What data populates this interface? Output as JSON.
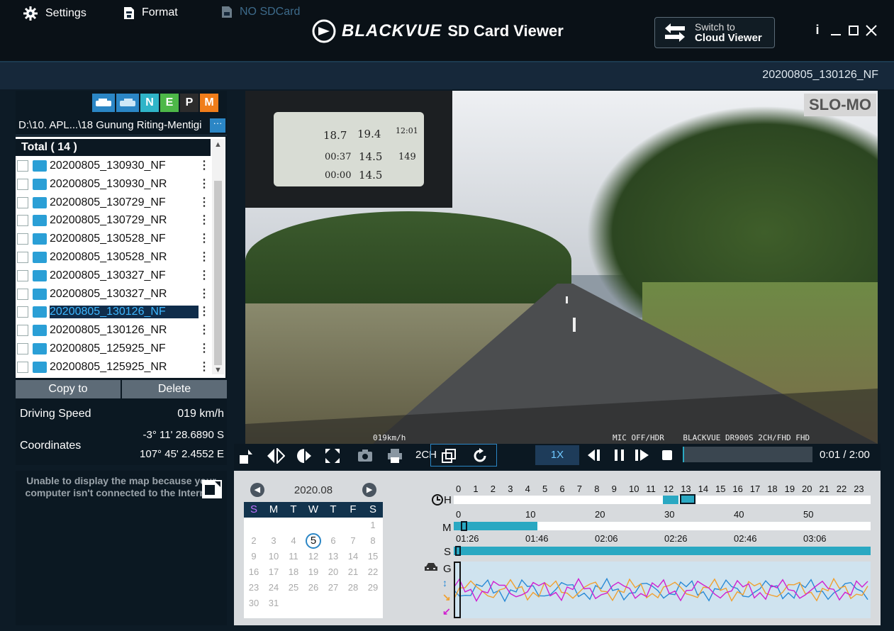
{
  "app": {
    "brand": "BLACKVUE",
    "title": "SD Card Viewer",
    "cloud_button_line1": "Switch to",
    "cloud_button_line2": "Cloud Viewer",
    "info_label": "i"
  },
  "menu": {
    "settings": "Settings",
    "format": "Format",
    "sdcard": "NO SDCard",
    "current_file": "20200805_130126_NF"
  },
  "file_panel": {
    "modes": [
      "N",
      "E",
      "P",
      "M"
    ],
    "path": "D:\\10. APL...\\18 Gunung Riting-Mentigi",
    "path_button": "···",
    "total_label": "Total ( 14 )",
    "files": [
      {
        "name": "20200805_130930_NF",
        "selected": false
      },
      {
        "name": "20200805_130930_NR",
        "selected": false
      },
      {
        "name": "20200805_130729_NF",
        "selected": false
      },
      {
        "name": "20200805_130729_NR",
        "selected": false
      },
      {
        "name": "20200805_130528_NF",
        "selected": false
      },
      {
        "name": "20200805_130528_NR",
        "selected": false
      },
      {
        "name": "20200805_130327_NF",
        "selected": false
      },
      {
        "name": "20200805_130327_NR",
        "selected": false
      },
      {
        "name": "20200805_130126_NF",
        "selected": true
      },
      {
        "name": "20200805_130126_NR",
        "selected": false
      },
      {
        "name": "20200805_125925_NF",
        "selected": false
      },
      {
        "name": "20200805_125925_NR",
        "selected": false
      }
    ],
    "copy_label": "Copy to",
    "delete_label": "Delete",
    "speed_label": "Driving Speed",
    "speed_value": "019 km/h",
    "coord_label": "Coordinates",
    "coord_lat": "-3° 11' 28.6890 S",
    "coord_lon": "107° 45' 2.4552 E"
  },
  "video": {
    "slomo_label": "SLO-MO",
    "osd_speed": "019km/h",
    "osd_info": "MIC OFF/HDR    BLACKVUE DR900S 2CH/FHD FHD",
    "pip_readings": [
      "18.7",
      "19.4",
      "12:01",
      "00:37",
      "14.5",
      "149",
      "00:00",
      "14.5"
    ]
  },
  "controls": {
    "channel_label": "2CH",
    "speed_label": "1X",
    "time": "0:01 / 2:00",
    "progress_fraction": 0.008
  },
  "map": {
    "message": "Unable to display the map because your computer isn't connected to the Internet."
  },
  "calendar": {
    "month": "2020.08",
    "dow": [
      "S",
      "M",
      "T",
      "W",
      "T",
      "F",
      "S"
    ],
    "selected_day": "5"
  },
  "timeline": {
    "h_label": "H",
    "m_label": "M",
    "s_label": "S",
    "g_label": "G",
    "h_ticks": [
      "0",
      "1",
      "2",
      "3",
      "4",
      "5",
      "6",
      "7",
      "8",
      "9",
      "10",
      "11",
      "12",
      "13",
      "14",
      "15",
      "16",
      "17",
      "18",
      "19",
      "20",
      "21",
      "22",
      "23"
    ],
    "m_ticks": [
      "0",
      "10",
      "20",
      "30",
      "40",
      "50"
    ],
    "s_ticks": [
      "01:26",
      "01:46",
      "02:06",
      "02:26",
      "02:46",
      "03:06"
    ]
  },
  "colors": {
    "accent": "#2aa8c2",
    "mode_n": "#2fb4c8",
    "mode_e": "#4db848",
    "mode_p": "#2c2c2c",
    "mode_m": "#f07d1a",
    "g_series": [
      "#2a8ad6",
      "#f0a030",
      "#d020d0"
    ]
  },
  "icons": [
    "settings-gear-icon",
    "format-icon",
    "sdcard-icon",
    "camera-icon",
    "print-icon",
    "rotate-icon"
  ]
}
